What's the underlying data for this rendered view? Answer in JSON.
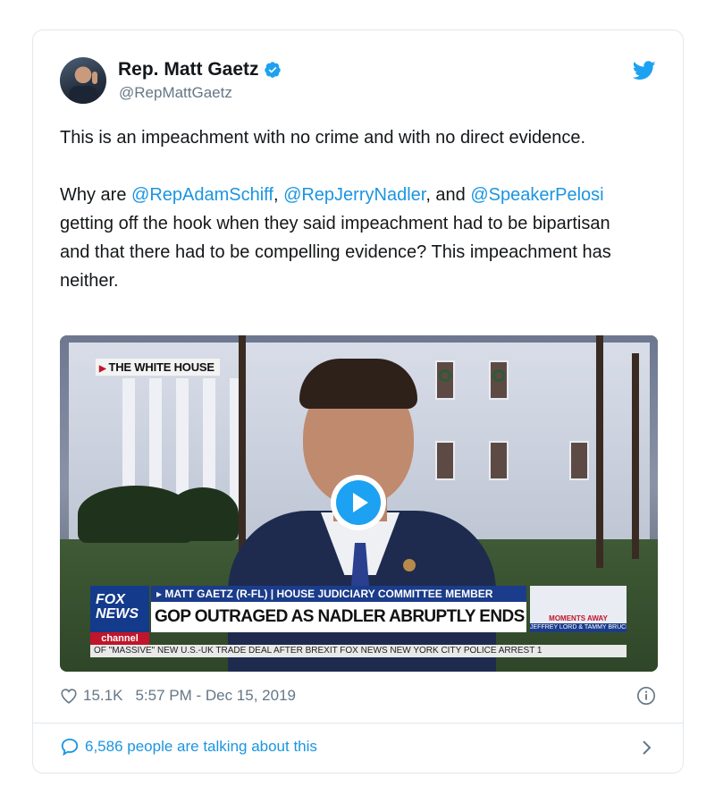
{
  "tweet": {
    "author": {
      "name": "Rep. Matt Gaetz",
      "handle": "@RepMattGaetz",
      "verified": true
    },
    "text": {
      "line1": "This is an impeachment with no crime and with no direct evidence.",
      "p2_prefix": "Why are ",
      "mention1": "@RepAdamSchiff",
      "sep1": ", ",
      "mention2": "@RepJerryNadler",
      "sep2": ", and ",
      "mention3": "@SpeakerPelosi",
      "p2_suffix": " getting off the hook when they said impeachment had to be bipartisan and that there had to be compelling evidence? This impeachment has neither."
    },
    "media": {
      "location_tag": "THE WHITE HOUSE",
      "fox_logo_line1": "FOX",
      "fox_logo_line2": "NEWS",
      "fox_logo_channel": "channel",
      "strap_top": "▸ MATT GAETZ (R-FL) | HOUSE JUDICIARY COMMITTEE MEMBER",
      "strap_main": "GOP OUTRAGED AS NADLER ABRUPTLY ENDS HEARING",
      "promo_moments": "MOMENTS AWAY",
      "promo_names": "JEFFREY LORD & TAMMY BRUCE",
      "ticker": "OF \"MASSIVE\" NEW U.S.-UK TRADE DEAL AFTER BREXIT    FOX NEWS    NEW YORK CITY POLICE ARREST 1"
    },
    "likes": "15.1K",
    "timestamp": "5:57 PM - Dec 15, 2019",
    "talking": "6,586 people are talking about this"
  },
  "colors": {
    "link": "#1b95e0",
    "twitter_blue": "#1da1f2",
    "muted": "#657786",
    "border": "#e1e8ed"
  },
  "icons": [
    "verified-badge-icon",
    "twitter-bird-icon",
    "play-icon",
    "heart-icon",
    "info-icon",
    "speech-bubble-icon",
    "chevron-right-icon"
  ]
}
